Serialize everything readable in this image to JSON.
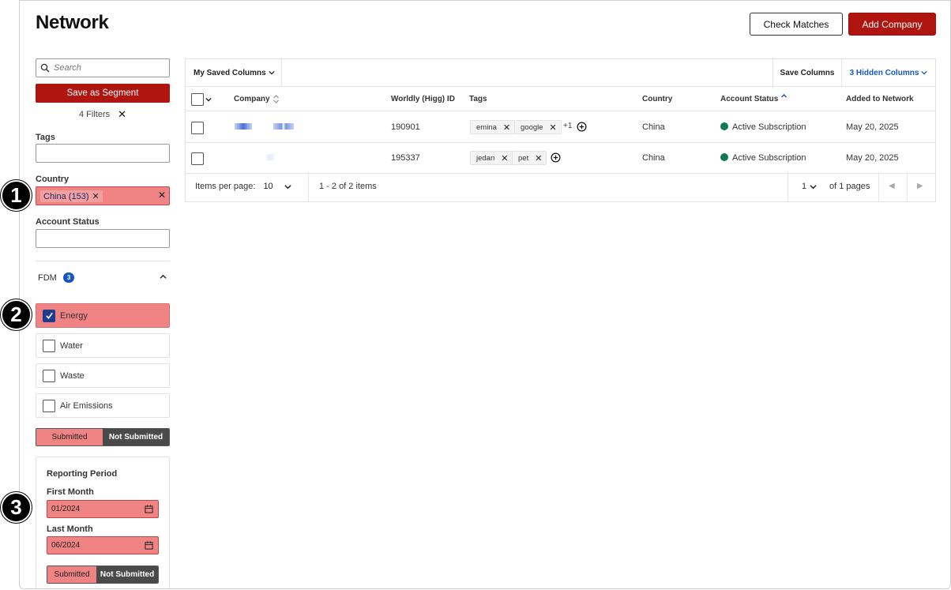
{
  "header": {
    "title": "Network",
    "check_matches_label": "Check Matches",
    "add_company_label": "Add Company"
  },
  "sidebar": {
    "search_placeholder": "Search",
    "save_segment_label": "Save as Segment",
    "filters_count": "4 Filters",
    "filters_clear": "✕",
    "tags_label": "Tags",
    "country_label": "Country",
    "country_chip": "China (153)",
    "chip_remove": "✕",
    "country_clear": "✕",
    "account_status_label": "Account Status",
    "fdm_label": "FDM",
    "fdm_count": "3",
    "fdm_options": [
      {
        "label": "Energy",
        "checked": true
      },
      {
        "label": "Water",
        "checked": false
      },
      {
        "label": "Waste",
        "checked": false
      },
      {
        "label": "Air Emissions",
        "checked": false
      }
    ],
    "submitted_label": "Submitted",
    "not_submitted_label": "Not Submitted",
    "reporting_period": {
      "title": "Reporting Period",
      "first_month_label": "First Month",
      "first_month_value": "01/2024",
      "last_month_label": "Last Month",
      "last_month_value": "06/2024",
      "submitted_label": "Submitted",
      "not_submitted_label": "Not Submitted"
    }
  },
  "table": {
    "saved_columns_label": "My Saved Columns",
    "save_columns_label": "Save Columns",
    "hidden_columns_label": "3 Hidden Columns",
    "columns": [
      "Company",
      "Worldly (Higg) ID",
      "Tags",
      "Country",
      "Account Status",
      "Added to Network"
    ],
    "rows": [
      {
        "id": "190901",
        "tags": [
          "emina",
          "google"
        ],
        "more_tags": "+1",
        "country": "China",
        "status": "Active Subscription",
        "added": "May 20, 2025"
      },
      {
        "id": "195337",
        "tags": [
          "jedan",
          "pet"
        ],
        "more_tags": "",
        "country": "China",
        "status": "Active Subscription",
        "added": "May 20, 2025"
      }
    ],
    "tag_remove": "✕",
    "pager": {
      "items_per_page_label": "Items per page:",
      "items_per_page_value": "10",
      "range": "1 - 2 of 2 items",
      "page_value": "1",
      "of_pages": "of 1 pages",
      "prev": "◀",
      "next": "▶"
    }
  },
  "markers": [
    "1",
    "2",
    "3"
  ],
  "colors": {
    "brand_red": "#b0140f",
    "highlight": "#f08383",
    "link_blue": "#1557c0",
    "status_green": "#0f7a55"
  }
}
